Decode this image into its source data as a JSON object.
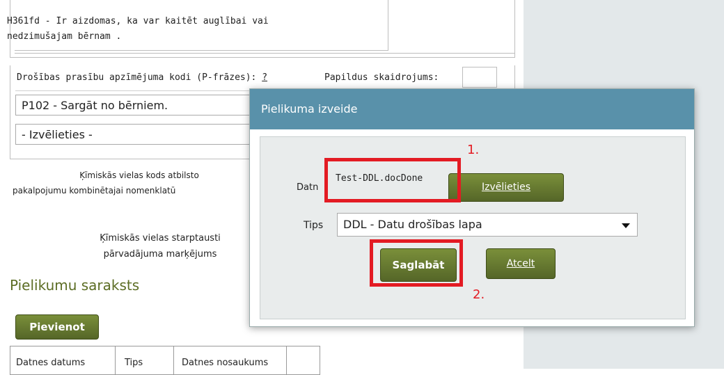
{
  "hazard": {
    "text_line1": "H361fd - Ir aizdomas, ka var kaitēt auglībai vai",
    "text_line2": "nedzimušajam bērnam ."
  },
  "precaution": {
    "header": "Drošības prasību apzīmējuma kodi (P-frāzes):",
    "help": "?",
    "extra_header": "Papildus skaidrojums:",
    "selected": "P102 - Sargāt no bērniem.",
    "placeholder": "- Izvēlieties -"
  },
  "notes": {
    "n1_line1": "Ķīmiskās vielas kods atbilsto",
    "n1_line2": "pakalpojumu kombinētajai nomenklatū",
    "n2_line1": "Ķīmiskās vielas starptausti",
    "n2_line2": "pārvadājuma marķējums"
  },
  "attachments": {
    "title": "Pielikumu saraksts",
    "add_button": "Pievienot",
    "columns": [
      "Datnes datums",
      "Tips",
      "Datnes nosaukums"
    ]
  },
  "dialog": {
    "title": "Pielikuma izveide",
    "file_label": "Datn",
    "file_value": "Test-DDL.docDone",
    "choose_button": "Izvēlieties",
    "type_label": "Tips",
    "type_value": "DDL - Datu drošības lapa",
    "save_button": "Saglabāt",
    "cancel_button": "Atcelt"
  },
  "annotations": {
    "step1": "1.",
    "step2": "2.",
    "color": "#e31b23"
  }
}
